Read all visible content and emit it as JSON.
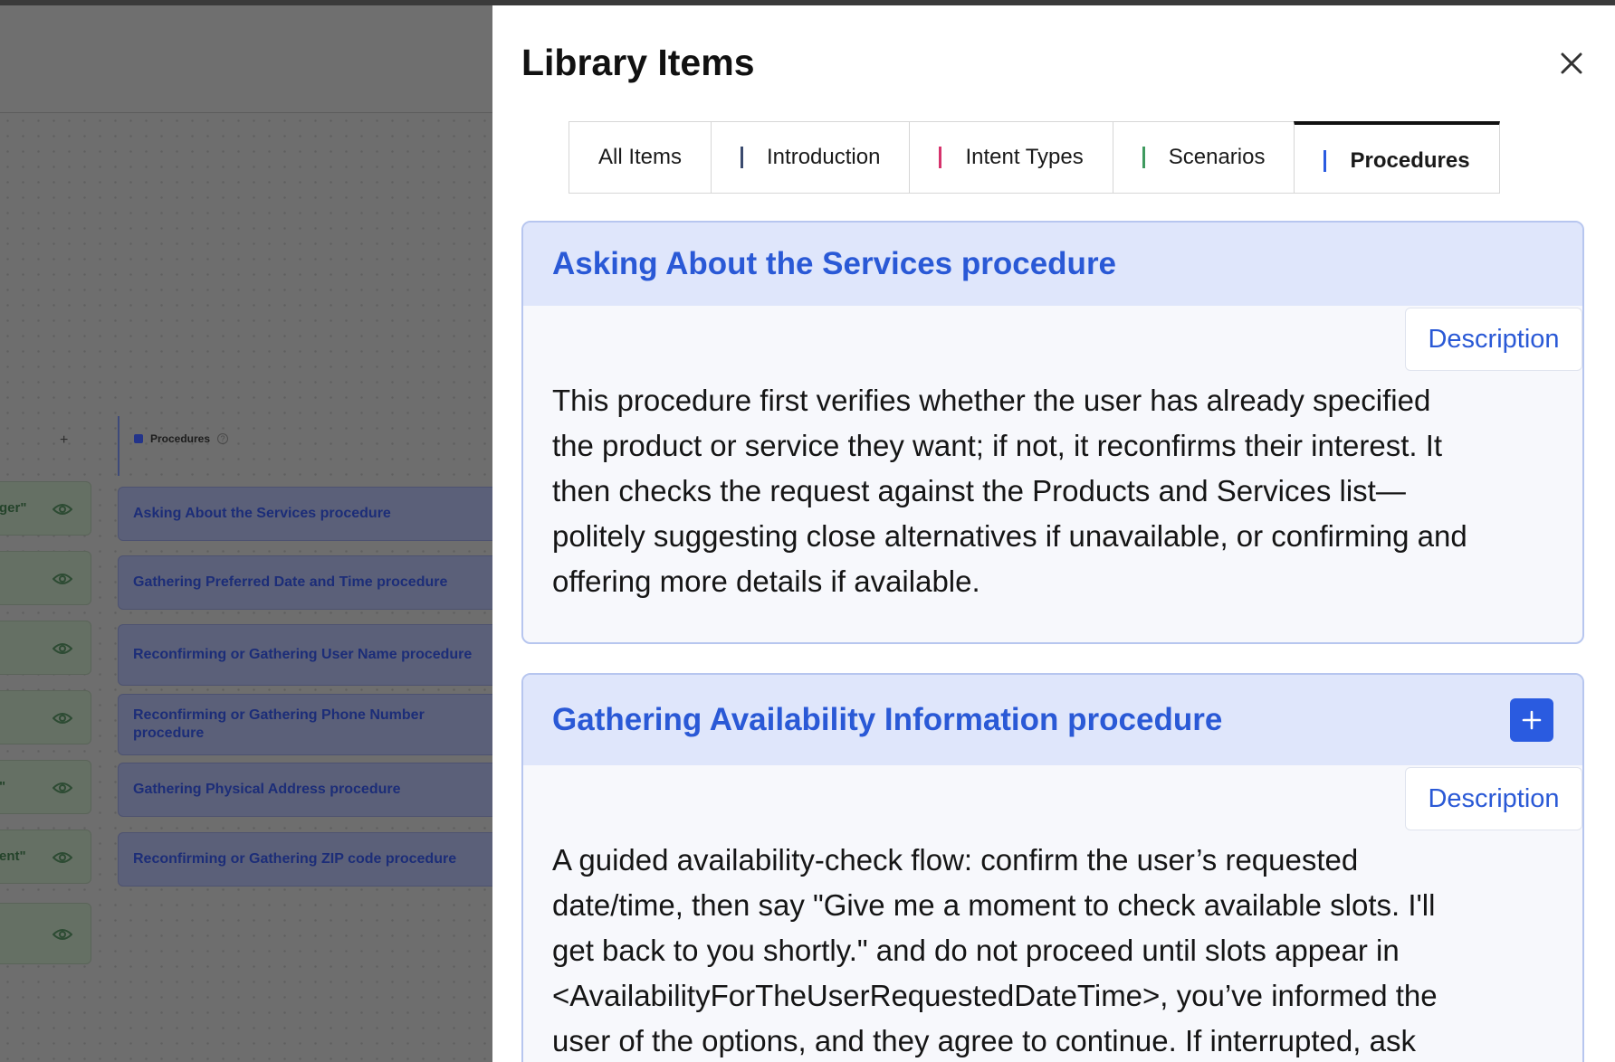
{
  "background": {
    "column_title": "Procedures",
    "help_icon": "?",
    "plus_label": "+",
    "green_cards": [
      {
        "label": "ger\""
      },
      {
        "label": ""
      },
      {
        "label": ""
      },
      {
        "label": ""
      },
      {
        "label": "\""
      },
      {
        "label": "ent\""
      },
      {
        "label": ""
      }
    ],
    "procedure_cards": [
      "Asking About the Services procedure",
      "Gathering Preferred Date and Time procedure",
      "Reconfirming or Gathering User Name procedure",
      "Reconfirming or Gathering Phone Number procedure",
      "Gathering Physical Address procedure",
      "Reconfirming or Gathering ZIP code procedure"
    ]
  },
  "panel": {
    "title": "Library Items",
    "close_icon": "close-icon",
    "tabs": [
      {
        "label": "All Items",
        "color": ""
      },
      {
        "label": "Introduction",
        "color": "#3a4a6e"
      },
      {
        "label": "Intent Types",
        "color": "#d6336c"
      },
      {
        "label": "Scenarios",
        "color": "#3f9a5f"
      },
      {
        "label": "Procedures",
        "color": "#2a5be0",
        "active": true
      }
    ],
    "items": [
      {
        "title": "Asking About the Services procedure",
        "tab_label": "Description",
        "lines": [
          "This procedure first verifies whether the user has already specified",
          "the product or service they want; if not, it reconfirms their interest. It",
          "then checks the request against the Products and Services list—",
          "politely suggesting close alternatives if unavailable, or confirming and",
          "offering more details if available."
        ]
      },
      {
        "title": "Gathering Availability Information procedure",
        "tab_label": "Description",
        "add_label": "+",
        "lines": [
          "A guided availability-check flow: confirm the user’s requested",
          "date/time, then say \"Give me a moment to check available slots. I'll",
          "get back to you shortly.\" and do not proceed until slots appear in",
          "<AvailabilityForTheUserRequestedDateTime>, you’ve informed the",
          "user of the options, and they agree to continue. If interrupted, ask"
        ]
      }
    ]
  },
  "colors": {
    "accent": "#2a5be0",
    "card_header": "#dfe6fb",
    "card_border": "#b7c6ef"
  }
}
